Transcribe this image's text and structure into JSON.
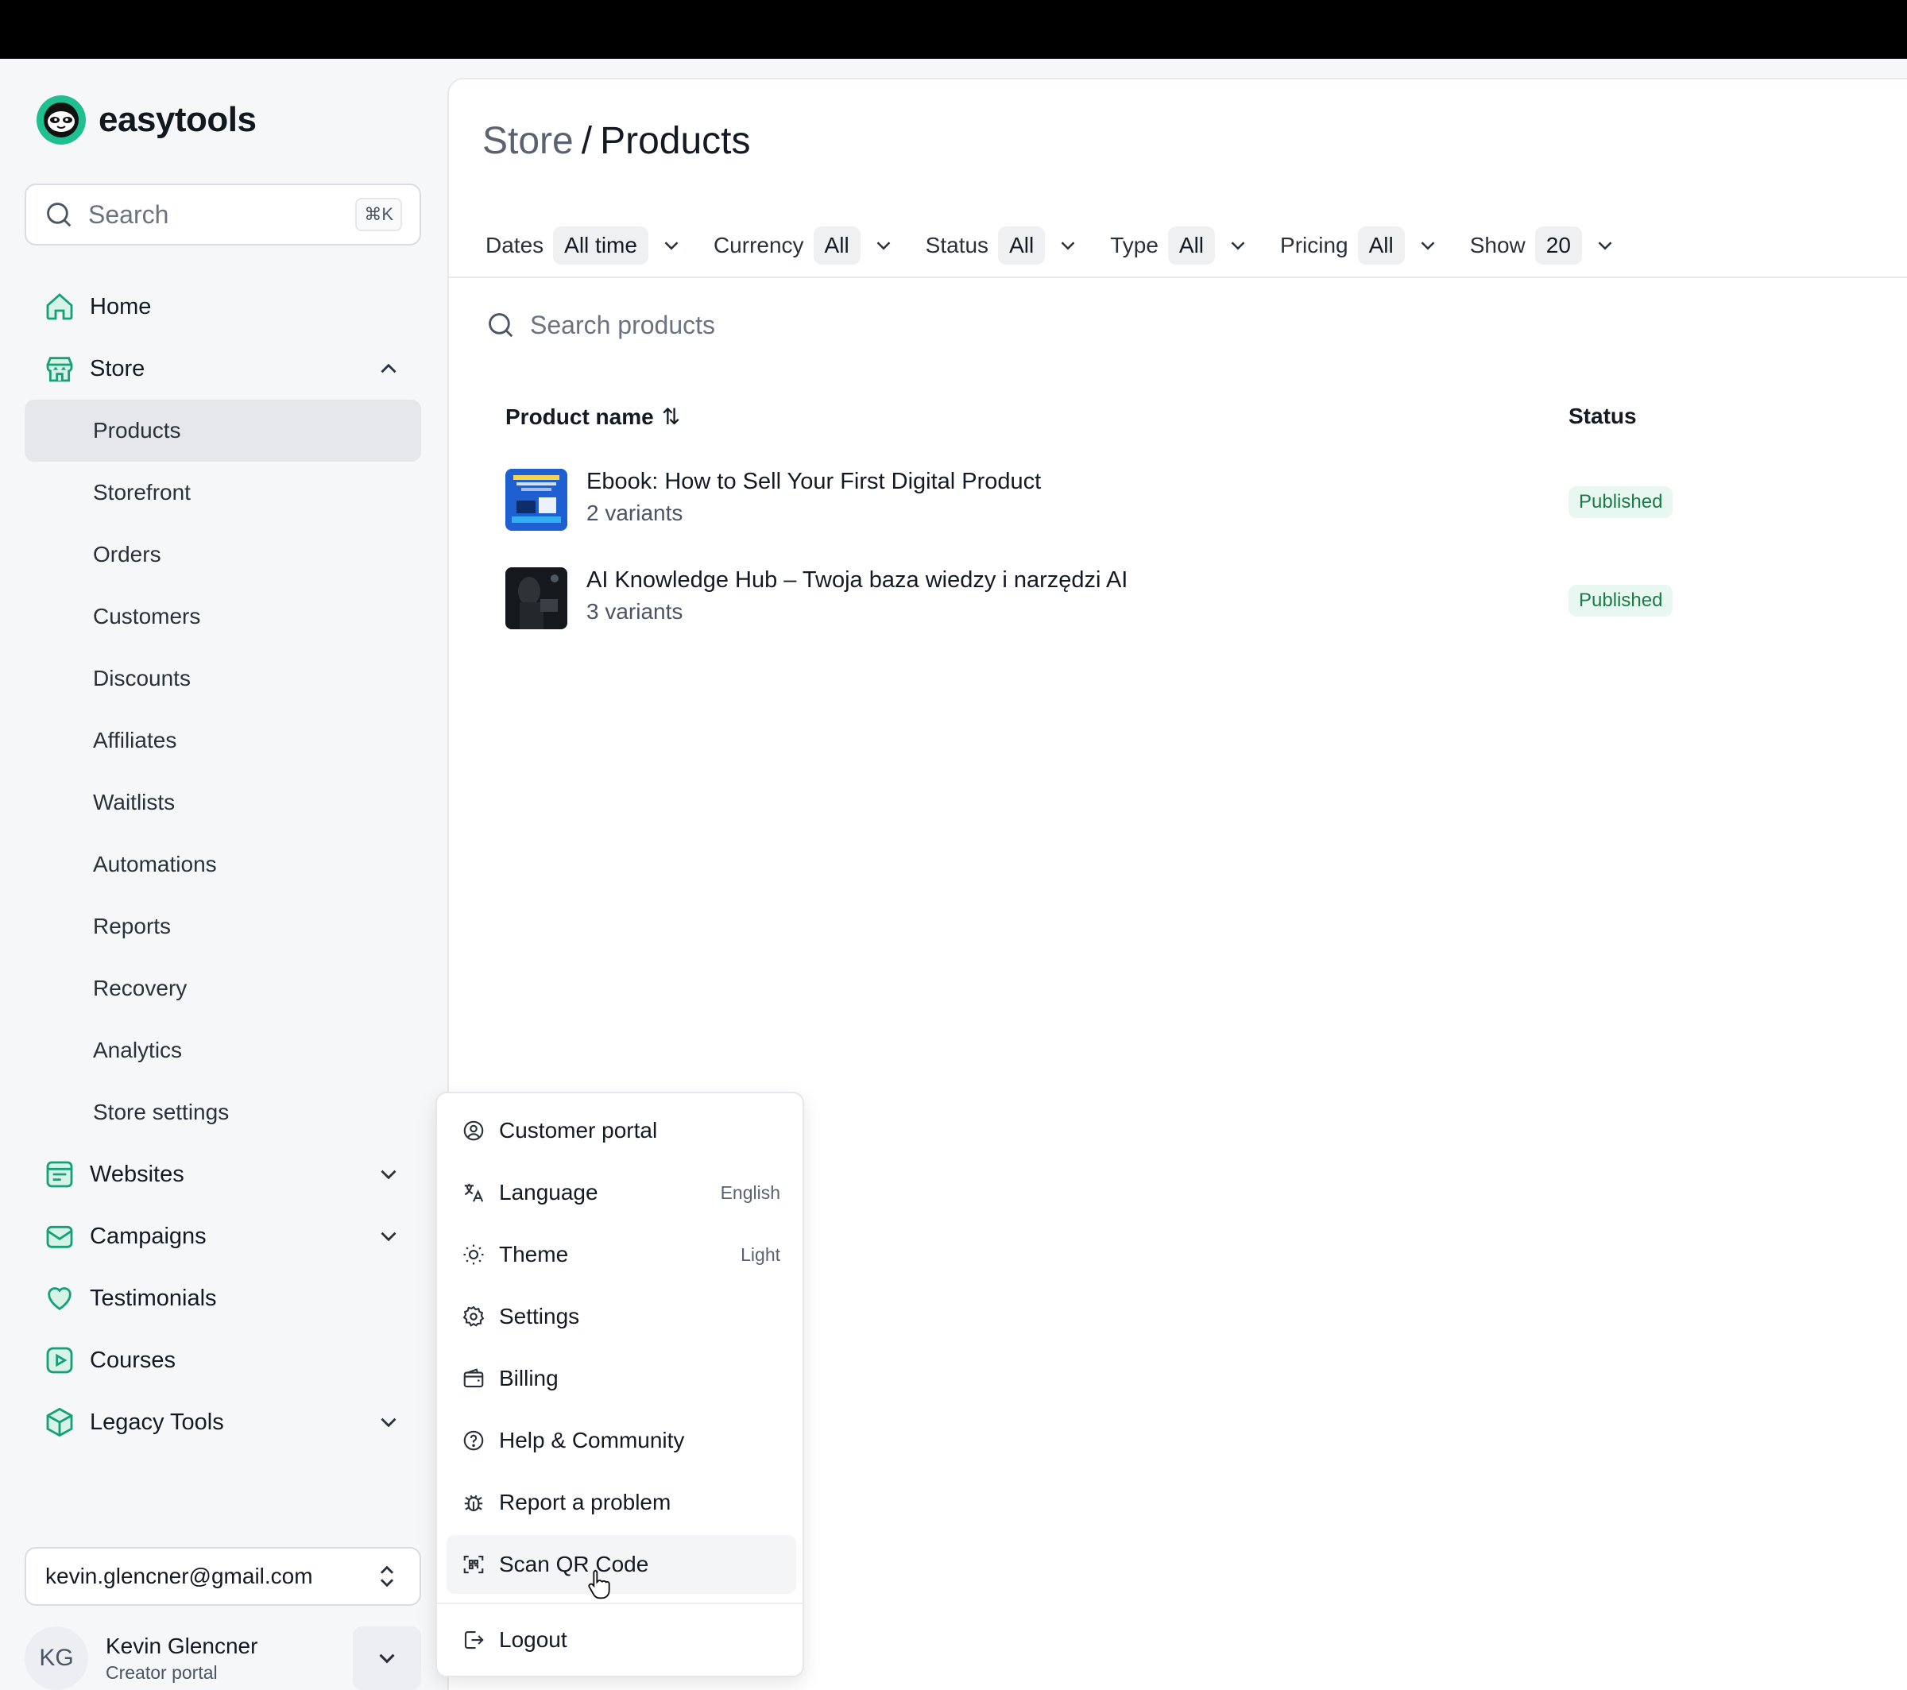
{
  "brand": {
    "name": "easytools"
  },
  "sidebar": {
    "search_placeholder": "Search",
    "search_shortcut": "⌘K",
    "items": [
      {
        "label": "Home",
        "icon": "home-icon"
      },
      {
        "label": "Store",
        "icon": "store-icon",
        "expanded": true
      },
      {
        "label": "Websites",
        "icon": "websites-icon"
      },
      {
        "label": "Campaigns",
        "icon": "campaigns-icon"
      },
      {
        "label": "Testimonials",
        "icon": "heart-icon"
      },
      {
        "label": "Courses",
        "icon": "courses-icon"
      },
      {
        "label": "Legacy Tools",
        "icon": "cube-icon"
      }
    ],
    "store_subitems": [
      "Products",
      "Storefront",
      "Orders",
      "Customers",
      "Discounts",
      "Affiliates",
      "Waitlists",
      "Automations",
      "Reports",
      "Recovery",
      "Analytics",
      "Store settings"
    ],
    "account_email": "kevin.glencner@gmail.com",
    "user": {
      "initials": "KG",
      "name": "Kevin Glencner",
      "role": "Creator portal"
    }
  },
  "main": {
    "breadcrumb_parent": "Store",
    "breadcrumb_sep": "/",
    "breadcrumb_current": "Products",
    "filters": [
      {
        "label": "Dates",
        "value": "All time"
      },
      {
        "label": "Currency",
        "value": "All"
      },
      {
        "label": "Status",
        "value": "All"
      },
      {
        "label": "Type",
        "value": "All"
      },
      {
        "label": "Pricing",
        "value": "All"
      },
      {
        "label": "Show",
        "value": "20"
      }
    ],
    "search_placeholder": "Search products",
    "columns": {
      "name": "Product name",
      "sort_icon": "⇅",
      "status": "Status"
    },
    "products": [
      {
        "title": "Ebook: How to Sell Your First Digital Product",
        "variants": "2 variants",
        "status": "Published"
      },
      {
        "title": "AI Knowledge Hub – Twoja baza wiedzy i narzędzi AI",
        "variants": "3 variants",
        "status": "Published"
      }
    ]
  },
  "menu": {
    "items": [
      {
        "label": "Customer portal",
        "icon": "user-circle-icon"
      },
      {
        "label": "Language",
        "icon": "translate-icon",
        "value": "English"
      },
      {
        "label": "Theme",
        "icon": "sun-icon",
        "value": "Light"
      },
      {
        "label": "Settings",
        "icon": "gear-icon"
      },
      {
        "label": "Billing",
        "icon": "wallet-icon"
      },
      {
        "label": "Help & Community",
        "icon": "help-icon"
      },
      {
        "label": "Report a problem",
        "icon": "bug-icon"
      },
      {
        "label": "Scan QR Code",
        "icon": "qr-scan-icon"
      },
      {
        "label": "Logout",
        "icon": "logout-icon"
      }
    ]
  },
  "colors": {
    "accent": "#1fbf8f",
    "badge_bg": "#e8f7ef",
    "badge_text": "#1b7a49"
  }
}
